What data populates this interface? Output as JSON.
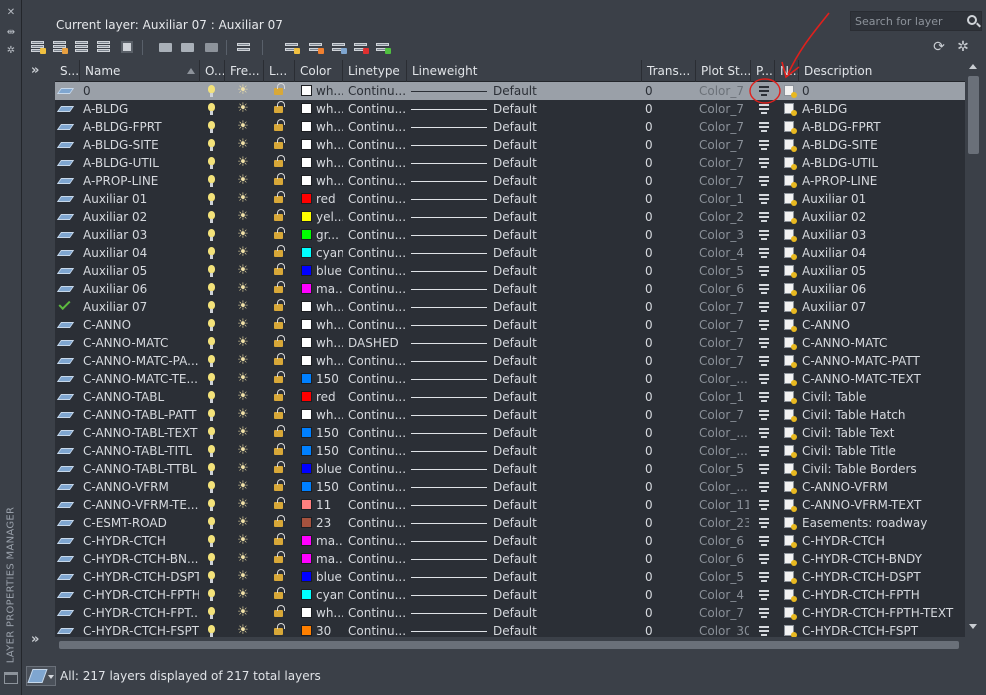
{
  "palette_title": "LAYER PROPERTIES MANAGER",
  "current_layer": "Current layer: Auxiliar 07 : Auxiliar 07",
  "search": {
    "placeholder": "Search for layer"
  },
  "columns": {
    "status": "S...",
    "name": "Name",
    "on": "O...",
    "freeze": "Fre...",
    "lock": "L...",
    "color": "Color",
    "linetype": "Linetype",
    "lineweight": "Lineweight",
    "transparency": "Trans...",
    "plot_style": "Plot St...",
    "plot": "P...",
    "new_vp_freeze": "N...",
    "description": "Description"
  },
  "rows": [
    {
      "name": "0",
      "color_name": "wh...",
      "color_hex": "#ffffff",
      "linetype": "Continu...",
      "lineweight": "Default",
      "transparency": "0",
      "plot_style": "Color_7",
      "description": "0",
      "selected": true
    },
    {
      "name": "A-BLDG",
      "color_name": "wh...",
      "color_hex": "#ffffff",
      "linetype": "Continu...",
      "lineweight": "Default",
      "transparency": "0",
      "plot_style": "Color_7",
      "description": "A-BLDG"
    },
    {
      "name": "A-BLDG-FPRT",
      "color_name": "wh...",
      "color_hex": "#ffffff",
      "linetype": "Continu...",
      "lineweight": "Default",
      "transparency": "0",
      "plot_style": "Color_7",
      "description": "A-BLDG-FPRT"
    },
    {
      "name": "A-BLDG-SITE",
      "color_name": "wh...",
      "color_hex": "#ffffff",
      "linetype": "Continu...",
      "lineweight": "Default",
      "transparency": "0",
      "plot_style": "Color_7",
      "description": "A-BLDG-SITE"
    },
    {
      "name": "A-BLDG-UTIL",
      "color_name": "wh...",
      "color_hex": "#ffffff",
      "linetype": "Continu...",
      "lineweight": "Default",
      "transparency": "0",
      "plot_style": "Color_7",
      "description": "A-BLDG-UTIL"
    },
    {
      "name": "A-PROP-LINE",
      "color_name": "wh...",
      "color_hex": "#ffffff",
      "linetype": "Continu...",
      "lineweight": "Default",
      "transparency": "0",
      "plot_style": "Color_7",
      "description": "A-PROP-LINE"
    },
    {
      "name": "Auxiliar 01",
      "color_name": "red",
      "color_hex": "#ff0000",
      "linetype": "Continu...",
      "lineweight": "Default",
      "transparency": "0",
      "plot_style": "Color_1",
      "description": "Auxiliar 01"
    },
    {
      "name": "Auxiliar 02",
      "color_name": "yel...",
      "color_hex": "#ffff00",
      "linetype": "Continu...",
      "lineweight": "Default",
      "transparency": "0",
      "plot_style": "Color_2",
      "description": "Auxiliar 02"
    },
    {
      "name": "Auxiliar 03",
      "color_name": "gr...",
      "color_hex": "#00ff00",
      "linetype": "Continu...",
      "lineweight": "Default",
      "transparency": "0",
      "plot_style": "Color_3",
      "description": "Auxiliar 03"
    },
    {
      "name": "Auxiliar 04",
      "color_name": "cyan",
      "color_hex": "#00ffff",
      "linetype": "Continu...",
      "lineweight": "Default",
      "transparency": "0",
      "plot_style": "Color_4",
      "description": "Auxiliar 04"
    },
    {
      "name": "Auxiliar 05",
      "color_name": "blue",
      "color_hex": "#0000ff",
      "linetype": "Continu...",
      "lineweight": "Default",
      "transparency": "0",
      "plot_style": "Color_5",
      "description": "Auxiliar 05"
    },
    {
      "name": "Auxiliar 06",
      "color_name": "ma...",
      "color_hex": "#ff00ff",
      "linetype": "Continu...",
      "lineweight": "Default",
      "transparency": "0",
      "plot_style": "Color_6",
      "description": "Auxiliar 06"
    },
    {
      "name": "Auxiliar 07",
      "color_name": "wh...",
      "color_hex": "#ffffff",
      "linetype": "Continu...",
      "lineweight": "Default",
      "transparency": "0",
      "plot_style": "Color_7",
      "description": "Auxiliar 07",
      "current": true
    },
    {
      "name": "C-ANNO",
      "color_name": "wh...",
      "color_hex": "#ffffff",
      "linetype": "Continu...",
      "lineweight": "Default",
      "transparency": "0",
      "plot_style": "Color_7",
      "description": "C-ANNO"
    },
    {
      "name": "C-ANNO-MATC",
      "color_name": "wh...",
      "color_hex": "#ffffff",
      "linetype": "DASHED",
      "lineweight": "Default",
      "transparency": "0",
      "plot_style": "Color_7",
      "description": "C-ANNO-MATC"
    },
    {
      "name": "C-ANNO-MATC-PA...",
      "color_name": "wh...",
      "color_hex": "#ffffff",
      "linetype": "Continu...",
      "lineweight": "Default",
      "transparency": "0",
      "plot_style": "Color_7",
      "description": "C-ANNO-MATC-PATT"
    },
    {
      "name": "C-ANNO-MATC-TE...",
      "color_name": "150",
      "color_hex": "#0080ff",
      "linetype": "Continu...",
      "lineweight": "Default",
      "transparency": "0",
      "plot_style": "Color_...",
      "description": "C-ANNO-MATC-TEXT"
    },
    {
      "name": "C-ANNO-TABL",
      "color_name": "red",
      "color_hex": "#ff0000",
      "linetype": "Continu...",
      "lineweight": "Default",
      "transparency": "0",
      "plot_style": "Color_1",
      "description": "Civil: Table"
    },
    {
      "name": "C-ANNO-TABL-PATT",
      "color_name": "wh...",
      "color_hex": "#ffffff",
      "linetype": "Continu...",
      "lineweight": "Default",
      "transparency": "0",
      "plot_style": "Color_7",
      "description": "Civil: Table Hatch"
    },
    {
      "name": "C-ANNO-TABL-TEXT",
      "color_name": "150",
      "color_hex": "#0080ff",
      "linetype": "Continu...",
      "lineweight": "Default",
      "transparency": "0",
      "plot_style": "Color_...",
      "description": "Civil: Table Text"
    },
    {
      "name": "C-ANNO-TABL-TITL",
      "color_name": "150",
      "color_hex": "#0080ff",
      "linetype": "Continu...",
      "lineweight": "Default",
      "transparency": "0",
      "plot_style": "Color_...",
      "description": "Civil: Table Title"
    },
    {
      "name": "C-ANNO-TABL-TTBL",
      "color_name": "blue",
      "color_hex": "#0000ff",
      "linetype": "Continu...",
      "lineweight": "Default",
      "transparency": "0",
      "plot_style": "Color_5",
      "description": "Civil: Table Borders"
    },
    {
      "name": "C-ANNO-VFRM",
      "color_name": "150",
      "color_hex": "#0080ff",
      "linetype": "Continu...",
      "lineweight": "Default",
      "transparency": "0",
      "plot_style": "Color_...",
      "description": "C-ANNO-VFRM"
    },
    {
      "name": "C-ANNO-VFRM-TE...",
      "color_name": "11",
      "color_hex": "#ff7f7f",
      "linetype": "Continu...",
      "lineweight": "Default",
      "transparency": "0",
      "plot_style": "Color_11",
      "description": "C-ANNO-VFRM-TEXT"
    },
    {
      "name": "C-ESMT-ROAD",
      "color_name": "23",
      "color_hex": "#a5523e",
      "linetype": "Continu...",
      "lineweight": "Default",
      "transparency": "0",
      "plot_style": "Color_23",
      "description": "Easements:  roadway"
    },
    {
      "name": "C-HYDR-CTCH",
      "color_name": "ma...",
      "color_hex": "#ff00ff",
      "linetype": "Continu...",
      "lineweight": "Default",
      "transparency": "0",
      "plot_style": "Color_6",
      "description": "C-HYDR-CTCH"
    },
    {
      "name": "C-HYDR-CTCH-BN...",
      "color_name": "ma...",
      "color_hex": "#ff00ff",
      "linetype": "Continu...",
      "lineweight": "Default",
      "transparency": "0",
      "plot_style": "Color_6",
      "description": "C-HYDR-CTCH-BNDY"
    },
    {
      "name": "C-HYDR-CTCH-DSPT",
      "color_name": "blue",
      "color_hex": "#0000ff",
      "linetype": "Continu...",
      "lineweight": "Default",
      "transparency": "0",
      "plot_style": "Color_5",
      "description": "C-HYDR-CTCH-DSPT"
    },
    {
      "name": "C-HYDR-CTCH-FPTH",
      "color_name": "cyan",
      "color_hex": "#00ffff",
      "linetype": "Continu...",
      "lineweight": "Default",
      "transparency": "0",
      "plot_style": "Color_4",
      "description": "C-HYDR-CTCH-FPTH"
    },
    {
      "name": "C-HYDR-CTCH-FPT...",
      "color_name": "wh...",
      "color_hex": "#ffffff",
      "linetype": "Continu...",
      "lineweight": "Default",
      "transparency": "0",
      "plot_style": "Color_7",
      "description": "C-HYDR-CTCH-FPTH-TEXT"
    },
    {
      "name": "C-HYDR-CTCH-FSPT",
      "color_name": "30",
      "color_hex": "#ff7f00",
      "linetype": "Continu...",
      "lineweight": "Default",
      "transparency": "0",
      "plot_style": "Color_30",
      "description": "C-HYDR-CTCH-FSPT"
    }
  ],
  "status_bar": {
    "text": "All: 217 layers displayed of 217 total layers"
  },
  "annotation": {
    "color": "#e0201c"
  }
}
